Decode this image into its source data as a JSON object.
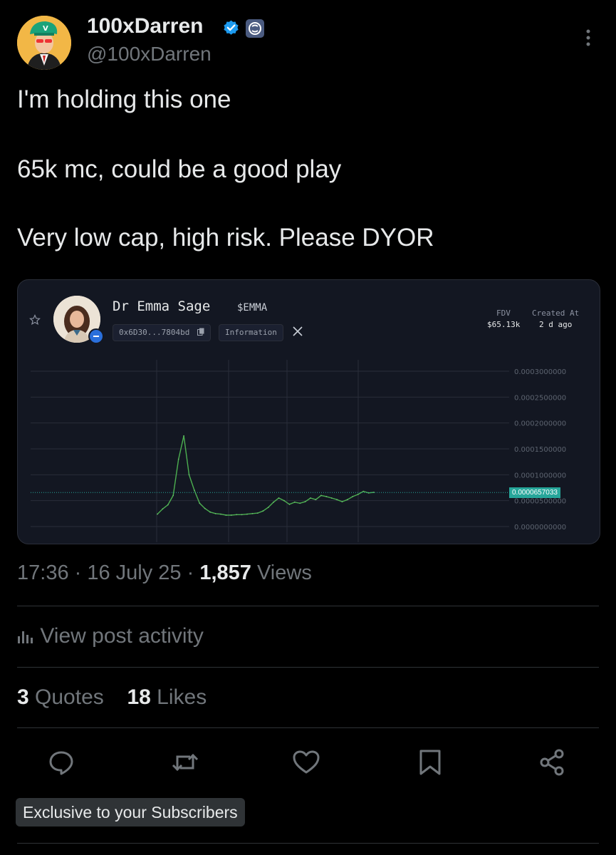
{
  "author": {
    "display_name": "100xDarren",
    "handle": "@100xDarren",
    "avatar_icon": "avatar-image",
    "verified_color": "#1d9bf0"
  },
  "post": {
    "line1": "I'm holding this one",
    "line2": "65k mc, could be a good play",
    "line3": "Very low cap, high risk. Please DYOR"
  },
  "card": {
    "token_name": "Dr Emma Sage",
    "ticker": "$EMMA",
    "address": "0x6D30...7804bd",
    "info_label": "Information",
    "x_label": "X",
    "fdv_label": "FDV",
    "fdv_value": "$65.13k",
    "created_label": "Created At",
    "created_value": "2 d ago",
    "current_price": "0.0000657033",
    "accent_color": "#26a69a",
    "chart_data": {
      "type": "line",
      "title": "",
      "xlabel": "",
      "ylabel": "",
      "ylim": [
        0,
        0.0003
      ],
      "y_ticks": [
        "0.0000000000",
        "0.0000500000",
        "0.0001000000",
        "0.0001500000",
        "0.0002000000",
        "0.0002500000",
        "0.0003000000"
      ],
      "series": [
        {
          "values": [
            2.4e-05,
            3.4e-05,
            4.2e-05,
            6e-05,
            0.00013,
            0.000175,
            0.0001,
            7e-05,
            4.5e-05,
            3.5e-05,
            2.8e-05,
            2.5e-05,
            2.4e-05,
            2.2e-05,
            2.2e-05,
            2.3e-05,
            2.3e-05,
            2.4e-05,
            2.5e-05,
            2.6e-05,
            3e-05,
            3.7e-05,
            4.7e-05,
            5.5e-05,
            5e-05,
            4.3e-05,
            4.7e-05,
            4.5e-05,
            4.8e-05,
            5.5e-05,
            5.2e-05,
            6e-05,
            5.8e-05,
            5.5e-05,
            5.2e-05,
            4.8e-05,
            5.2e-05,
            5.8e-05,
            6.2e-05,
            6.8e-05,
            6.5e-05,
            6.6e-05
          ]
        }
      ]
    }
  },
  "meta": {
    "time": "17:36",
    "date": "16 July 25",
    "views_count": "1,857",
    "views_label": "Views"
  },
  "activity": {
    "label": "View post activity"
  },
  "stats": {
    "quotes_count": "3",
    "quotes_label": "Quotes",
    "likes_count": "18",
    "likes_label": "Likes"
  },
  "actions": {
    "reply_icon": "reply-icon",
    "repost_icon": "repost-icon",
    "like_icon": "like-icon",
    "bookmark_icon": "bookmark-icon",
    "share_icon": "share-icon"
  },
  "badge": {
    "label": "Exclusive to your Subscribers"
  }
}
